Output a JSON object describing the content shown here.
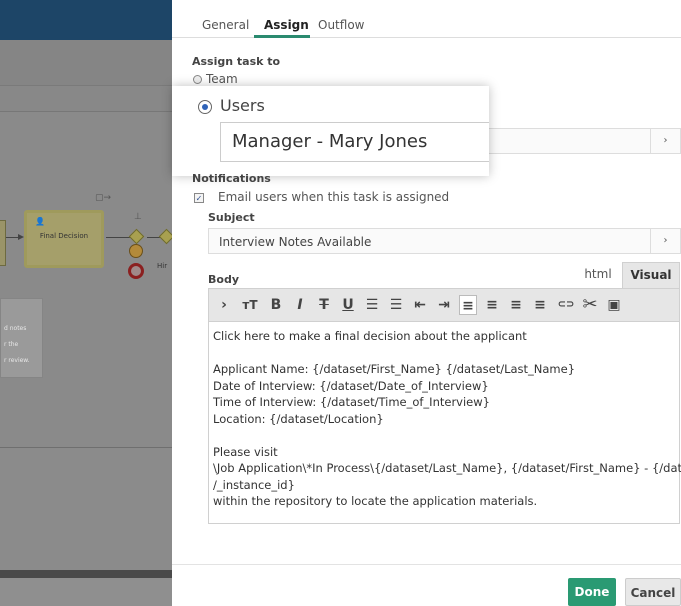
{
  "canvas": {
    "task_label": "Final Decision",
    "hire_label": "Hir",
    "note_lines": [
      "d notes",
      "r the",
      "r review."
    ]
  },
  "tabs": [
    {
      "label": "General"
    },
    {
      "label": "Assign"
    },
    {
      "label": "Outflow"
    }
  ],
  "assign": {
    "heading": "Assign task to",
    "team_label": "Team",
    "users_label": "Users",
    "users_value": "Manager - Mary Jones",
    "dropdown_chevron": "›"
  },
  "notifications": {
    "heading": "Notifications",
    "email_label": "Email users when this task is assigned",
    "email_checked": true,
    "subject_label": "Subject",
    "subject_value": "Interview Notes Available",
    "body_label": "Body",
    "mode_tabs": [
      {
        "label": "html"
      },
      {
        "label": "Visual"
      }
    ],
    "active_mode": "Visual"
  },
  "toolbar": {
    "items": [
      {
        "name": "expand-icon",
        "glyph": "›"
      },
      {
        "name": "font-size-icon",
        "glyph": "тT"
      },
      {
        "name": "bold-icon",
        "glyph": "B"
      },
      {
        "name": "italic-icon",
        "glyph": "I"
      },
      {
        "name": "strikethrough-icon",
        "glyph": "T"
      },
      {
        "name": "underline-icon",
        "glyph": "U"
      },
      {
        "name": "bullet-list-icon",
        "glyph": "☰"
      },
      {
        "name": "numbered-list-icon",
        "glyph": "☰"
      },
      {
        "name": "outdent-icon",
        "glyph": "⇤"
      },
      {
        "name": "indent-icon",
        "glyph": "⇥"
      },
      {
        "name": "align-left-icon",
        "glyph": "≡"
      },
      {
        "name": "align-center-icon",
        "glyph": "≡"
      },
      {
        "name": "align-right-icon",
        "glyph": "≡"
      },
      {
        "name": "justify-icon",
        "glyph": "≡"
      },
      {
        "name": "link-icon",
        "glyph": "⊂⊃"
      },
      {
        "name": "cut-icon",
        "glyph": "✂"
      },
      {
        "name": "image-icon",
        "glyph": "▣"
      }
    ]
  },
  "body_lines": [
    "Click here to make a final decision about the applicant",
    "",
    "Applicant Name: {/dataset/First_Name} {/dataset/Last_Name}",
    "Date of Interview: {/dataset/Date_of_Interview}",
    "Time of Interview: {/dataset/Time_of_Interview}",
    "Location: {/dataset/Location}",
    "",
    "Please visit",
    "\\Job Application\\*In Process\\{/dataset/Last_Name}, {/dataset/First_Name} - {/dataset",
    "/_instance_id}",
    "within the repository to locate the application materials."
  ],
  "footer": {
    "done_label": "Done",
    "cancel_label": "Cancel"
  },
  "colors": {
    "accent": "#2a9a73",
    "header_dark": "#1d4567",
    "radio_selected": "#2f63b8"
  }
}
